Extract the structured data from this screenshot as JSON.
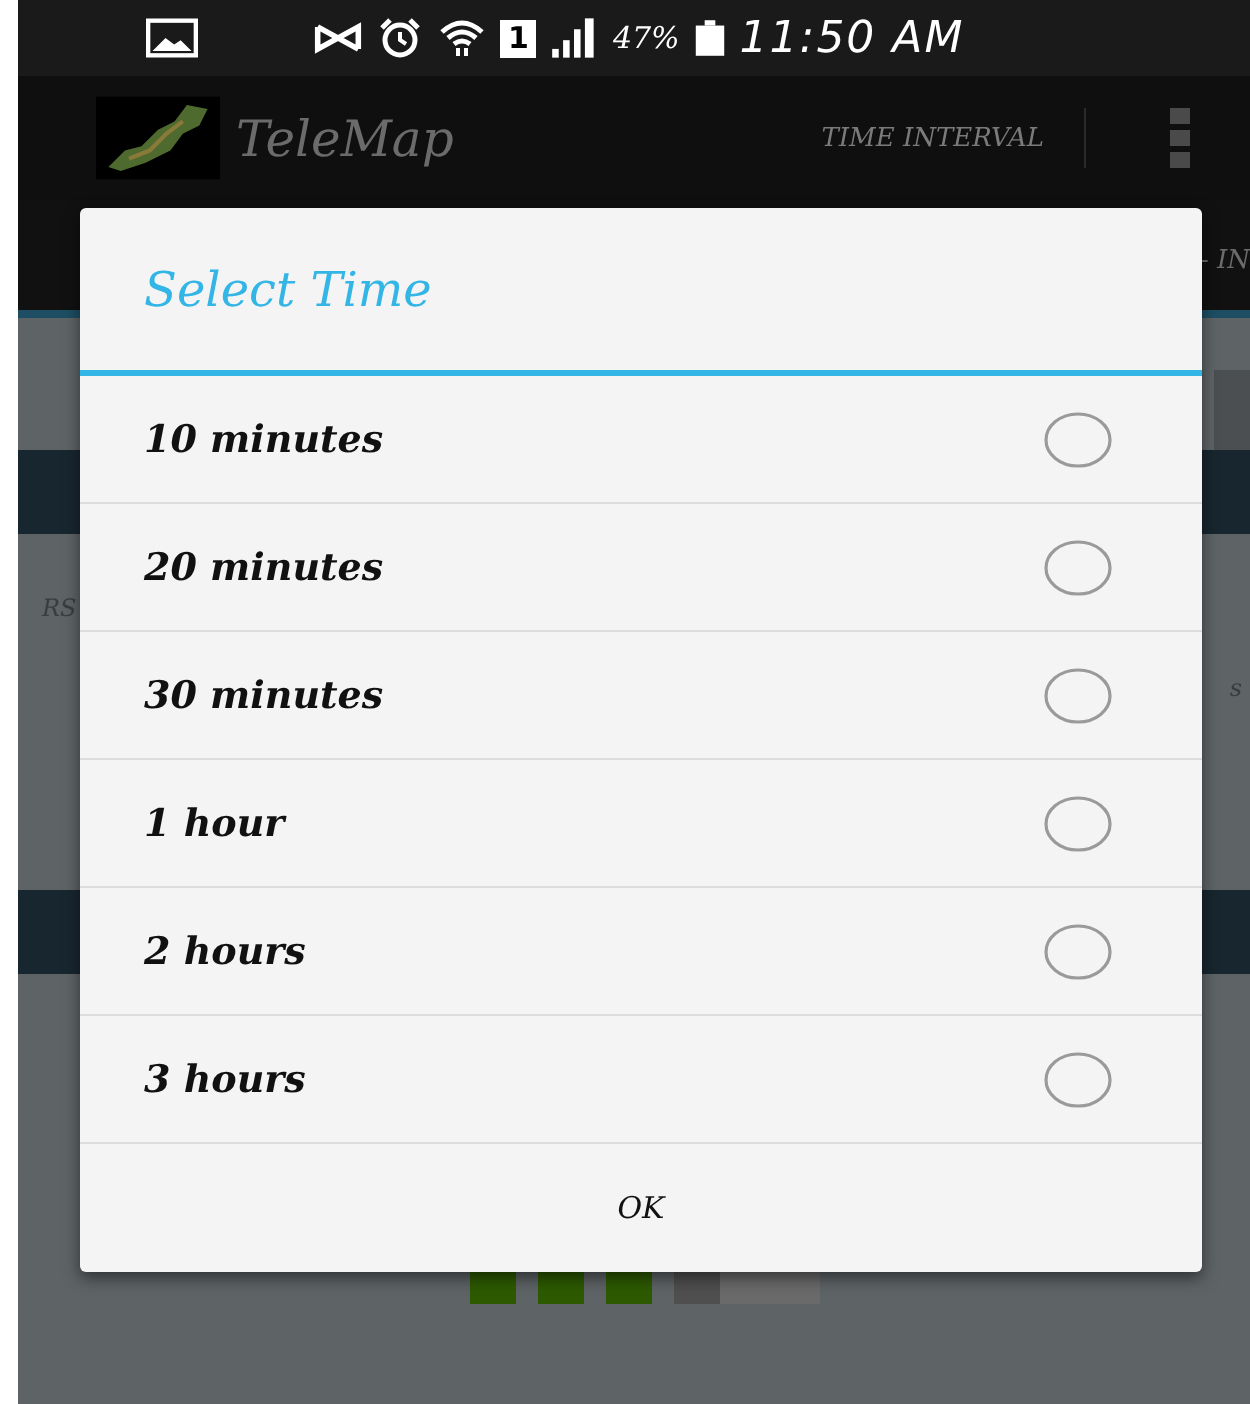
{
  "status_bar": {
    "battery_text": "47%",
    "sim": "1",
    "time": "11:50 AM"
  },
  "app_bar": {
    "title": "TeleMap",
    "action": "TIME INTERVAL"
  },
  "tab_fragment": "- IN",
  "background_fragments": [
    "RS",
    "s"
  ],
  "dialog": {
    "title": "Select Time",
    "options": [
      {
        "label": "10 minutes",
        "selected": false
      },
      {
        "label": "20 minutes",
        "selected": false
      },
      {
        "label": "30 minutes",
        "selected": false
      },
      {
        "label": "1 hour",
        "selected": false
      },
      {
        "label": "2 hours",
        "selected": false
      },
      {
        "label": "3 hours",
        "selected": false
      }
    ],
    "button": "OK"
  }
}
